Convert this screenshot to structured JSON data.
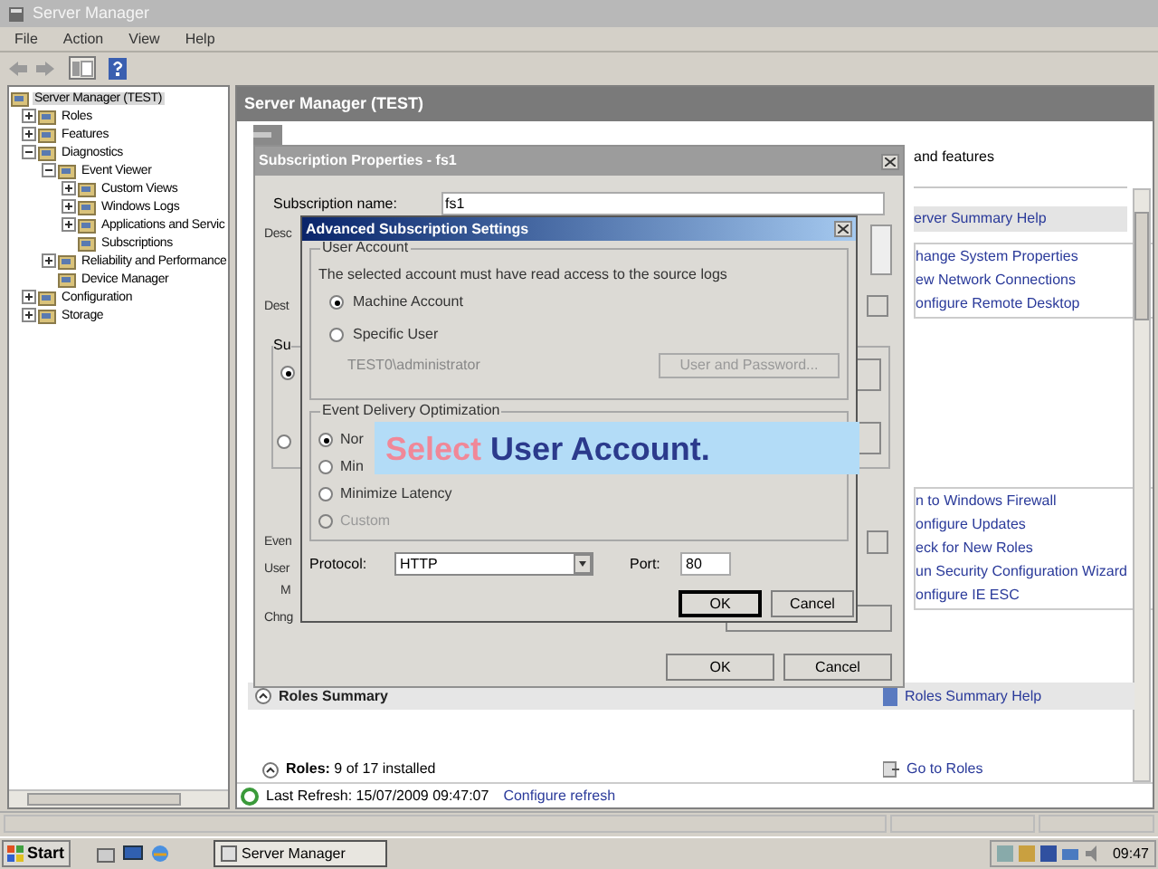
{
  "window": {
    "title": "Server Manager"
  },
  "menu": [
    "File",
    "Action",
    "View",
    "Help"
  ],
  "tree": [
    {
      "label": "Server Manager (TEST)",
      "expandable": false,
      "selected": true,
      "children": [
        {
          "label": "Roles",
          "expandable": true,
          "expanded": false,
          "selected": false
        },
        {
          "label": "Features",
          "expandable": true,
          "expanded": false,
          "selected": false
        },
        {
          "label": "Diagnostics",
          "expandable": true,
          "expanded": true,
          "selected": false,
          "children": [
            {
              "label": "Event Viewer",
              "expandable": true,
              "expanded": true,
              "selected": false,
              "children": [
                {
                  "label": "Custom Views",
                  "expandable": true,
                  "expanded": false,
                  "selected": false
                },
                {
                  "label": "Windows Logs",
                  "expandable": true,
                  "expanded": false,
                  "selected": false
                },
                {
                  "label": "Applications and Servic",
                  "expandable": true,
                  "expanded": false,
                  "selected": false
                },
                {
                  "label": "Subscriptions",
                  "expandable": false,
                  "selected": false
                }
              ]
            },
            {
              "label": "Reliability and Performance",
              "expandable": true,
              "expanded": false,
              "selected": false
            },
            {
              "label": "Device Manager",
              "expandable": false,
              "selected": false
            }
          ]
        },
        {
          "label": "Configuration",
          "expandable": true,
          "expanded": false,
          "selected": false
        },
        {
          "label": "Storage",
          "expandable": true,
          "expanded": false,
          "selected": false
        }
      ]
    }
  ],
  "content": {
    "header": "Server Manager (TEST)",
    "features_text": "and features",
    "help_header": "erver Summary Help",
    "links_1": [
      "hange System Properties",
      "ew Network Connections",
      "onfigure Remote Desktop"
    ],
    "links_2": [
      "n to Windows Firewall",
      "onfigure Updates",
      "eck for New Roles",
      "un Security Configuration Wizard",
      "onfigure IE ESC"
    ],
    "roles_summary": {
      "title": "Roles Summary",
      "help": "Roles Summary Help",
      "roles": "**Roles:** 9 of 17 installed",
      "go_to": "Go to Roles"
    },
    "refresh": {
      "text": "Last Refresh: 15/07/2009 09:47:07",
      "link": "Configure refresh"
    }
  },
  "subscription_dialog": {
    "title": "Subscription Properties - fs1",
    "name_label": "Subscription name:",
    "name_value": "fs1",
    "labels": [
      "Desc",
      "Dest",
      "Even",
      "User",
      "M",
      "Chng"
    ],
    "group_label": "Su",
    "radios": [
      {
        "selected": true
      },
      {
        "selected": false
      }
    ],
    "buttons": [
      "OK",
      "Cancel"
    ]
  },
  "advanced_dialog": {
    "title": "Advanced Subscription Settings",
    "user_group": {
      "title": "User Account",
      "note": "The selected account must have read access to the source logs",
      "options": [
        {
          "label": "Machine Account",
          "selected": true
        },
        {
          "label": "Specific User",
          "selected": false
        }
      ],
      "account": "TEST0\\administrator",
      "button": {
        "label": "User and Password...",
        "disabled": true
      }
    },
    "delivery_group": {
      "title": "Event Delivery Optimization",
      "options": [
        {
          "label": "Nor",
          "selected": true,
          "disabled": false
        },
        {
          "label": "Min",
          "selected": false,
          "disabled": false
        },
        {
          "label": "Minimize Latency",
          "selected": false,
          "disabled": false
        },
        {
          "label": "Custom",
          "selected": false,
          "disabled": true
        }
      ]
    },
    "protocol": {
      "label": "Protocol:",
      "value": "HTTP"
    },
    "port": {
      "label": "Port:",
      "value": "80"
    },
    "buttons": [
      "OK",
      "Cancel"
    ]
  },
  "banner": {
    "highlight": "Select",
    "text": "User Account."
  },
  "taskbar": {
    "start": "Start",
    "tasks": [
      {
        "label": "Server Manager",
        "selected": true
      }
    ],
    "clock": "09:47"
  }
}
